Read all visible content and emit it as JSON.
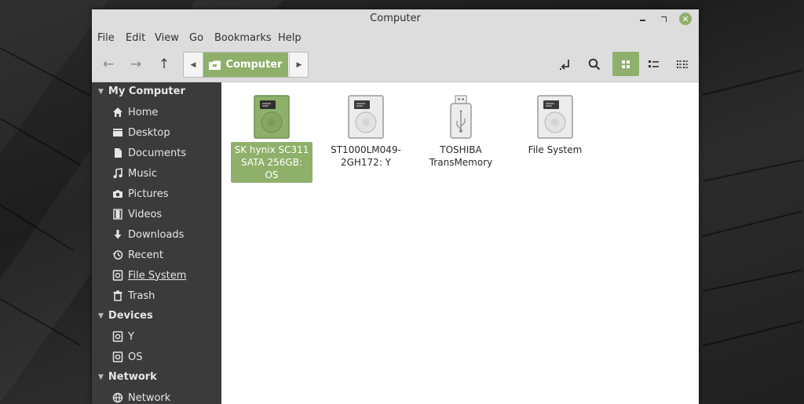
{
  "window": {
    "title": "Computer"
  },
  "menubar": {
    "items": [
      {
        "label": "File"
      },
      {
        "label": "Edit"
      },
      {
        "label": "View"
      },
      {
        "label": "Go"
      },
      {
        "label": "Bookmarks"
      },
      {
        "label": "Help"
      }
    ]
  },
  "toolbar": {
    "breadcrumb_current": "Computer",
    "accent_color": "#8fb06a"
  },
  "sidebar": {
    "sections": [
      {
        "title": "My Computer"
      },
      {
        "title": "Devices"
      },
      {
        "title": "Network"
      }
    ],
    "items": [
      {
        "label": "Home",
        "icon": "home-icon"
      },
      {
        "label": "Desktop",
        "icon": "desktop-icon"
      },
      {
        "label": "Documents",
        "icon": "documents-icon"
      },
      {
        "label": "Music",
        "icon": "music-icon"
      },
      {
        "label": "Pictures",
        "icon": "camera-icon"
      },
      {
        "label": "Videos",
        "icon": "film-icon"
      },
      {
        "label": "Downloads",
        "icon": "download-icon"
      },
      {
        "label": "Recent",
        "icon": "recent-icon"
      },
      {
        "label": "File System",
        "icon": "drive-icon",
        "active": true
      },
      {
        "label": "Trash",
        "icon": "trash-icon"
      },
      {
        "label": "Y",
        "icon": "drive-icon"
      },
      {
        "label": "OS",
        "icon": "drive-icon"
      },
      {
        "label": "Network",
        "icon": "network-icon"
      }
    ]
  },
  "content": {
    "items": [
      {
        "line1": "SK hynix SC311",
        "line2": "SATA 256GB: OS",
        "icon": "hard-drive-icon",
        "selected": true
      },
      {
        "line1": "ST1000LM049-",
        "line2": "2GH172: Y",
        "icon": "hard-drive-icon",
        "selected": false
      },
      {
        "line1": "TOSHIBA",
        "line2": "TransMemory",
        "icon": "usb-drive-icon",
        "selected": false
      },
      {
        "line1": "File System",
        "line2": "",
        "icon": "hard-drive-icon",
        "selected": false
      }
    ]
  }
}
